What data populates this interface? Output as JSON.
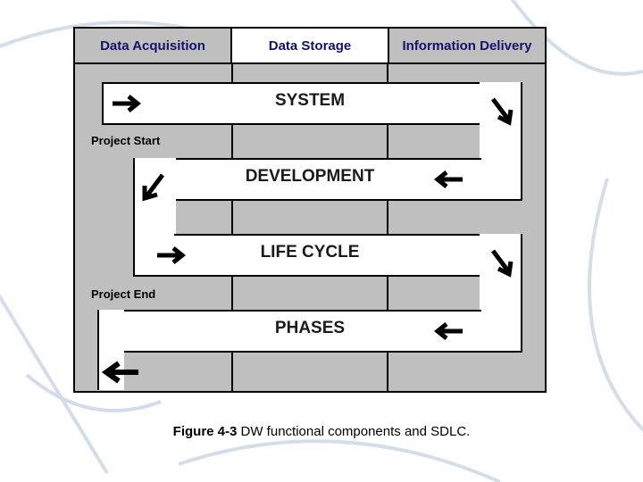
{
  "headers": {
    "left": "Data Acquisition",
    "mid": "Data Storage",
    "right": "Information Delivery"
  },
  "phases": {
    "p1": "SYSTEM",
    "p2": "DEVELOPMENT",
    "p3": "LIFE CYCLE",
    "p4": "PHASES"
  },
  "labels": {
    "start": "Project Start",
    "end": "Project End"
  },
  "caption": {
    "figref": "Figure 4-3",
    "text": " DW functional components and SDLC."
  }
}
